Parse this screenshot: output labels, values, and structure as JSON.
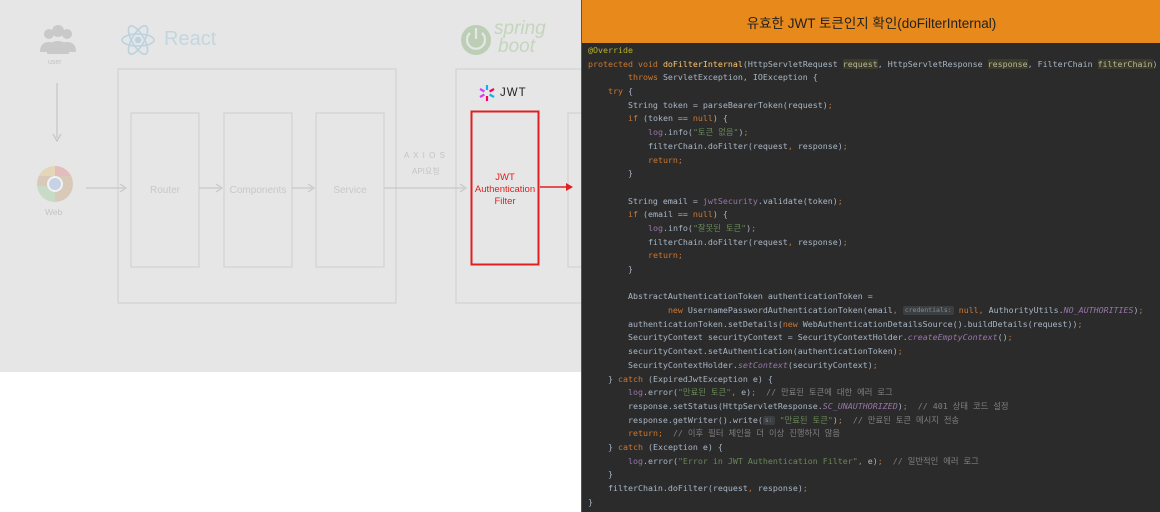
{
  "diagram": {
    "user_label": "user",
    "web_label": "Web",
    "react_logo_text": "React",
    "spring_logo_line1": "spring",
    "spring_logo_line2": "boot",
    "jwt_logo_text": "JWT",
    "router_label": "Router",
    "components_label": "Components",
    "service_label": "Service",
    "axios_label": "A X I O S",
    "api_request_label": "API요청",
    "jwt_filter_line1": "JWT",
    "jwt_filter_line2": "Authentication",
    "jwt_filter_line3": "Filter",
    "colors": {
      "highlight": "#e02020",
      "faded": "#c8c8c8",
      "background": "#e6e6e6"
    }
  },
  "code_panel": {
    "title": "유효한 JWT 토큰인지 확인(doFilterInternal)",
    "header_color": "#e8891c",
    "hint_credentials": "credentials:",
    "hint_s": "s:",
    "lines": [
      [
        [
          "an",
          "@Override"
        ]
      ],
      [
        [
          "kw",
          "protected void "
        ],
        [
          "fn",
          "doFilterInternal"
        ],
        [
          "",
          "(HttpServletRequest "
        ],
        [
          "hl",
          "request"
        ],
        [
          "",
          ", HttpServletResponse "
        ],
        [
          "hl",
          "response"
        ],
        [
          "",
          ", FilterChain "
        ],
        [
          "hl",
          "filterChain"
        ],
        [
          "",
          ")"
        ]
      ],
      [
        [
          "",
          "        "
        ],
        [
          "kw",
          "throws "
        ],
        [
          "",
          "ServletException, IOException {"
        ]
      ],
      [
        [
          "",
          "    "
        ],
        [
          "kw",
          "try "
        ],
        [
          "",
          "{"
        ]
      ],
      [
        [
          "",
          "        String token = parseBearerToken(request)"
        ],
        [
          "kw",
          ";"
        ]
      ],
      [
        [
          "",
          "        "
        ],
        [
          "kw",
          "if "
        ],
        [
          "",
          "(token == "
        ],
        [
          "kw",
          "null"
        ],
        [
          "",
          ") {"
        ]
      ],
      [
        [
          "",
          "            "
        ],
        [
          "lg",
          "log"
        ],
        [
          "",
          ".info("
        ],
        [
          "st",
          "\"토큰 없음\""
        ],
        [
          "",
          ")"
        ],
        [
          "kw",
          ";"
        ]
      ],
      [
        [
          "",
          "            filterChain.doFilter(request"
        ],
        [
          "kw",
          ", "
        ],
        [
          "",
          "response)"
        ],
        [
          "kw",
          ";"
        ]
      ],
      [
        [
          "",
          "            "
        ],
        [
          "kw",
          "return;"
        ]
      ],
      [
        [
          "",
          "        }"
        ]
      ],
      [
        [
          "",
          ""
        ]
      ],
      [
        [
          "",
          "        String email = "
        ],
        [
          "ft",
          "jwtSecurity"
        ],
        [
          "",
          ".validate(token)"
        ],
        [
          "kw",
          ";"
        ]
      ],
      [
        [
          "",
          "        "
        ],
        [
          "kw",
          "if "
        ],
        [
          "",
          "(email == "
        ],
        [
          "kw",
          "null"
        ],
        [
          "",
          ") {"
        ]
      ],
      [
        [
          "",
          "            "
        ],
        [
          "lg",
          "log"
        ],
        [
          "",
          ".info("
        ],
        [
          "st",
          "\"잘못된 토큰\""
        ],
        [
          "",
          ")"
        ],
        [
          "kw",
          ";"
        ]
      ],
      [
        [
          "",
          "            filterChain.doFilter(request"
        ],
        [
          "kw",
          ", "
        ],
        [
          "",
          "response)"
        ],
        [
          "kw",
          ";"
        ]
      ],
      [
        [
          "",
          "            "
        ],
        [
          "kw",
          "return;"
        ]
      ],
      [
        [
          "",
          "        }"
        ]
      ],
      [
        [
          "",
          ""
        ]
      ],
      [
        [
          "",
          "        AbstractAuthenticationToken authenticationToken ="
        ]
      ],
      [
        [
          "",
          "                "
        ],
        [
          "kw",
          "new "
        ],
        [
          "",
          "UsernamePasswordAuthenticationToken(email"
        ],
        [
          "kw",
          ", "
        ],
        [
          "hint",
          "credentials:"
        ],
        [
          "kw",
          " null, "
        ],
        [
          "",
          "AuthorityUtils."
        ],
        [
          "it",
          "NO_AUTHORITIES"
        ],
        [
          "",
          ")"
        ],
        [
          "kw",
          ";"
        ]
      ],
      [
        [
          "",
          "        authenticationToken.setDetails("
        ],
        [
          "kw",
          "new "
        ],
        [
          "",
          "WebAuthenticationDetailsSource().buildDetails(request))"
        ],
        [
          "kw",
          ";"
        ]
      ],
      [
        [
          "",
          "        SecurityContext securityContext = SecurityContextHolder."
        ],
        [
          "it",
          "createEmptyContext"
        ],
        [
          "",
          "()"
        ],
        [
          "kw",
          ";"
        ]
      ],
      [
        [
          "",
          "        securityContext.setAuthentication(authenticationToken)"
        ],
        [
          "kw",
          ";"
        ]
      ],
      [
        [
          "",
          "        SecurityContextHolder."
        ],
        [
          "it",
          "setContext"
        ],
        [
          "",
          "(securityContext)"
        ],
        [
          "kw",
          ";"
        ]
      ],
      [
        [
          "",
          "    } "
        ],
        [
          "kw",
          "catch "
        ],
        [
          "",
          "(ExpiredJwtException e) {"
        ]
      ],
      [
        [
          "",
          "        "
        ],
        [
          "lg",
          "log"
        ],
        [
          "",
          ".error("
        ],
        [
          "st",
          "\"만료된 토큰\""
        ],
        [
          "kw",
          ", "
        ],
        [
          "",
          "e)"
        ],
        [
          "kw",
          ";  "
        ],
        [
          "cm",
          "// 만료된 토큰에 대한 에러 로그"
        ]
      ],
      [
        [
          "",
          "        response.setStatus(HttpServletResponse."
        ],
        [
          "it",
          "SC_UNAUTHORIZED"
        ],
        [
          "",
          ")"
        ],
        [
          "kw",
          ";  "
        ],
        [
          "cm",
          "// 401 상태 코드 설정"
        ]
      ],
      [
        [
          "",
          "        response.getWriter().write("
        ],
        [
          "hint",
          "s:"
        ],
        [
          "st",
          " \"만료된 토큰\""
        ],
        [
          "",
          ")"
        ],
        [
          "kw",
          ";  "
        ],
        [
          "cm",
          "// 만료된 토큰 메시지 전송"
        ]
      ],
      [
        [
          "",
          "        "
        ],
        [
          "kw",
          "return;  "
        ],
        [
          "cm",
          "// 이후 필터 체인을 더 이상 진행하지 않음"
        ]
      ],
      [
        [
          "",
          "    } "
        ],
        [
          "kw",
          "catch "
        ],
        [
          "",
          "(Exception e) {"
        ]
      ],
      [
        [
          "",
          "        "
        ],
        [
          "lg",
          "log"
        ],
        [
          "",
          ".error("
        ],
        [
          "st",
          "\"Error in JWT Authentication Filter\""
        ],
        [
          "kw",
          ", "
        ],
        [
          "",
          "e)"
        ],
        [
          "kw",
          ";  "
        ],
        [
          "cm",
          "// 일반적인 에러 로그"
        ]
      ],
      [
        [
          "",
          "    }"
        ]
      ],
      [
        [
          "",
          "    filterChain.doFilter(request"
        ],
        [
          "kw",
          ", "
        ],
        [
          "",
          "response)"
        ],
        [
          "kw",
          ";"
        ]
      ],
      [
        [
          "",
          "}"
        ]
      ]
    ]
  }
}
